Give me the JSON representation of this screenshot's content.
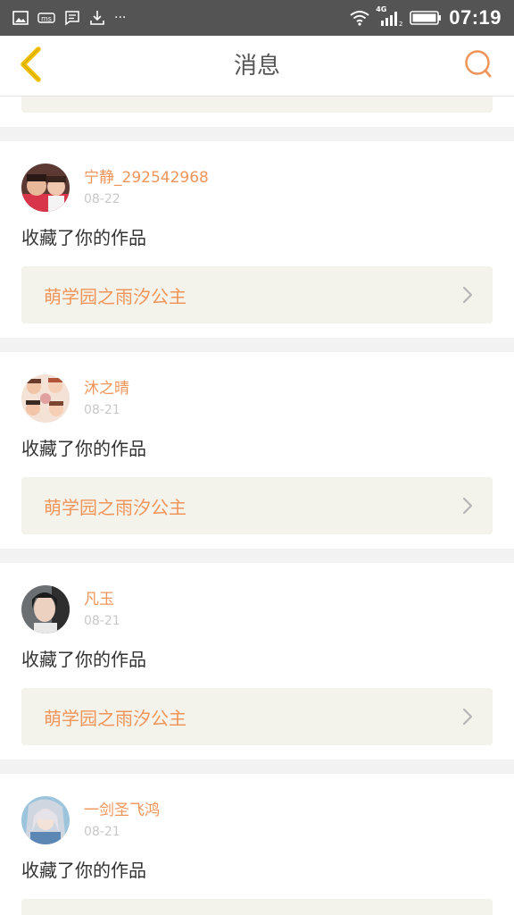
{
  "status_bar": {
    "time": "07:19",
    "network": "4G",
    "overflow": "···",
    "icons": [
      "gallery-icon",
      "app-icon",
      "message-icon",
      "download-icon",
      "wifi-icon",
      "signal-icon",
      "battery-icon"
    ]
  },
  "header": {
    "title": "消息",
    "back_icon": "chevron-left-icon",
    "search_icon": "search-icon"
  },
  "colors": {
    "accent": "#f0955a",
    "back": "#f2c000",
    "link_bg": "#f3f3ec",
    "date": "#c8c8c8"
  },
  "messages": [
    {
      "user": "宁静_292542968",
      "date": "08-22",
      "action": "收藏了你的作品",
      "work": "萌学园之雨汐公主"
    },
    {
      "user": "沐之晴",
      "date": "08-21",
      "action": "收藏了你的作品",
      "work": "萌学园之雨汐公主"
    },
    {
      "user": "凡玉",
      "date": "08-21",
      "action": "收藏了你的作品",
      "work": "萌学园之雨汐公主"
    },
    {
      "user": "一剑圣飞鸿",
      "date": "08-21",
      "action": "收藏了你的作品",
      "work": ""
    }
  ]
}
